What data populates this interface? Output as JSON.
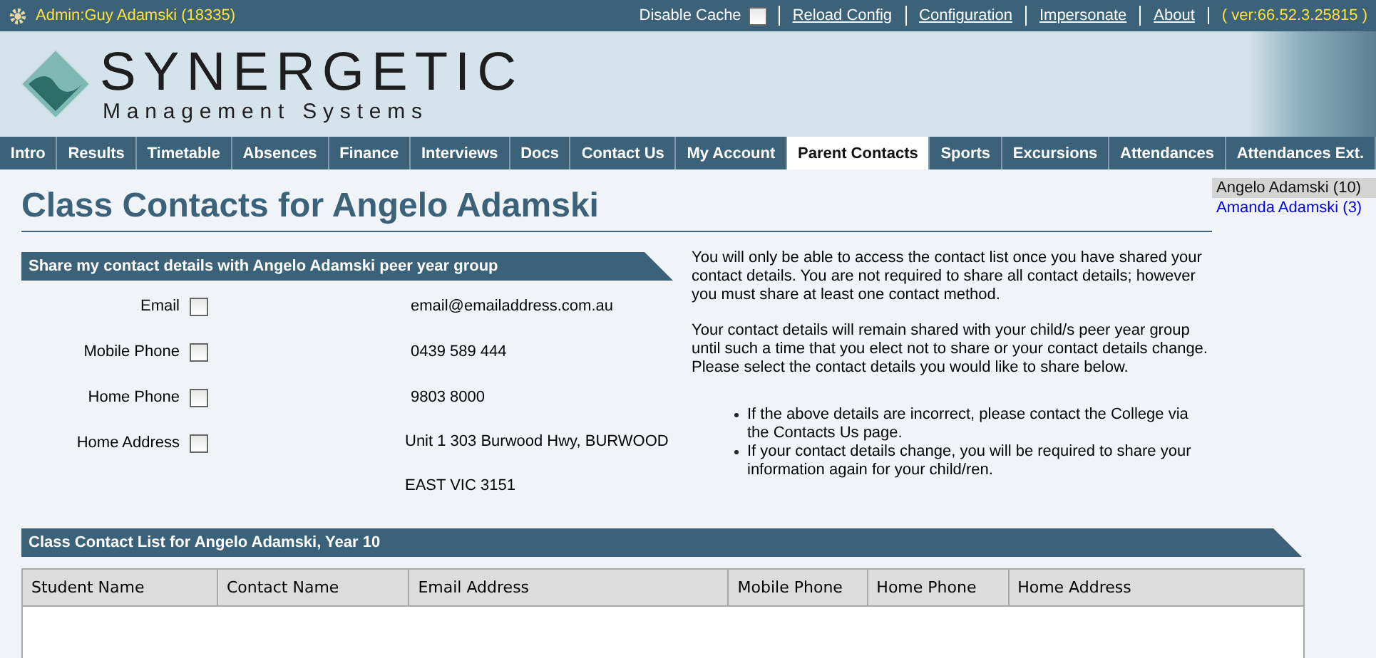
{
  "top_bar": {
    "user": "Admin:Guy Adamski (18335)",
    "disable_cache": {
      "label": "Disable Cache",
      "checked": false
    },
    "links": [
      "Reload Config",
      "Configuration",
      "Impersonate",
      "About"
    ],
    "version": "( ver:66.52.3.25815 )"
  },
  "header": {
    "logo_name": "SYNERGETIC",
    "logo_subtitle": "Management Systems"
  },
  "tabs": [
    {
      "label": "Intro",
      "selected": false
    },
    {
      "label": "Results",
      "selected": false
    },
    {
      "label": "Timetable",
      "selected": false
    },
    {
      "label": "Absences",
      "selected": false
    },
    {
      "label": "Finance",
      "selected": false
    },
    {
      "label": "Interviews",
      "selected": false
    },
    {
      "label": "Docs",
      "selected": false
    },
    {
      "label": "Contact Us",
      "selected": false
    },
    {
      "label": "My Account",
      "selected": false
    },
    {
      "label": "Parent Contacts",
      "selected": true
    },
    {
      "label": "Sports",
      "selected": false
    },
    {
      "label": "Excursions",
      "selected": false
    },
    {
      "label": "Attendances",
      "selected": false
    },
    {
      "label": "Attendances Ext.",
      "selected": false
    }
  ],
  "page": {
    "title": "Class Contacts for Angelo Adamski",
    "children": [
      {
        "label": "Angelo Adamski (10)",
        "selected": true
      },
      {
        "label": "Amanda Adamski (3)",
        "selected": false
      }
    ],
    "share_section": {
      "title": "Share my contact details with Angelo Adamski peer year group",
      "fields": [
        {
          "label": "Email",
          "checked": false,
          "value": "email@emailaddress.com.au"
        },
        {
          "label": "Mobile Phone",
          "checked": false,
          "value": "0439 589 444"
        },
        {
          "label": "Home Phone",
          "checked": false,
          "value": "9803 8000"
        },
        {
          "label": "Home Address",
          "checked": false,
          "value": "Unit 1 303 Burwood Hwy, BURWOOD EAST VIC 3151"
        }
      ],
      "info_paragraphs": [
        "You will only be able to access the contact list once you have shared your contact details. You are not required to share all contact details; however you must share at least one contact method.",
        "Your contact details will remain shared with your child/s peer year group until such a time that you elect not to share or your contact details change. Please select the contact details you would like to share below."
      ],
      "notes": [
        "If the above details are incorrect, please contact the College via the Contacts Us page.",
        "If your contact details change, you will be required to share your information again for your child/ren."
      ]
    },
    "contact_list": {
      "title": "Class Contact List for Angelo Adamski, Year 10",
      "columns": [
        "Student Name",
        "Contact Name",
        "Email Address",
        "Mobile Phone",
        "Home Phone",
        "Home Address"
      ]
    }
  }
}
